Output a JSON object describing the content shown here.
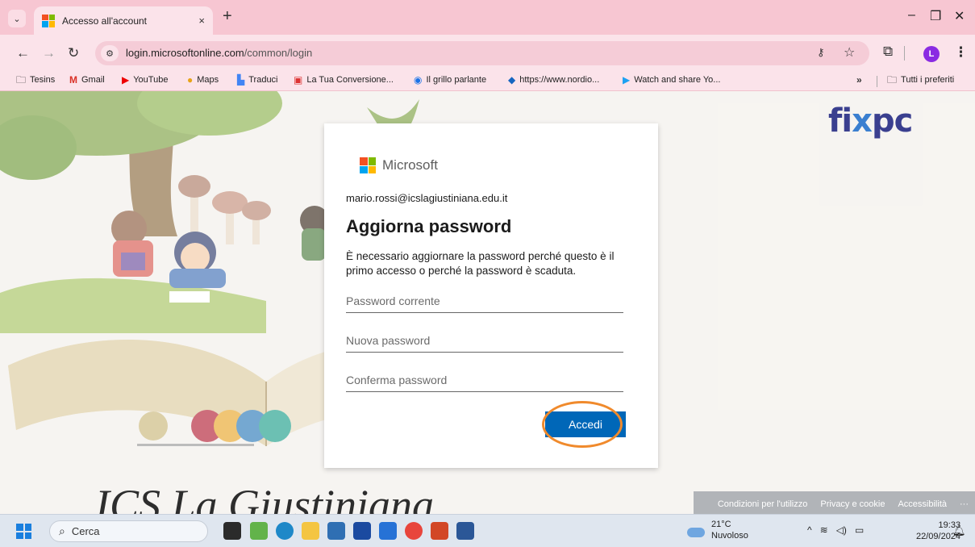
{
  "browser": {
    "tab_title": "Accesso all'account",
    "tab_close": "×",
    "new_tab": "+",
    "window_controls": {
      "minimize": "–",
      "restore": "❐",
      "close": "✕"
    },
    "url_host": "login.microsoftonline.com",
    "url_path": "/common/login",
    "profile_initial": "L",
    "bookmarks": [
      {
        "label": "Tesins",
        "icon": "folder-icon"
      },
      {
        "label": "Gmail",
        "icon": "gmail-icon"
      },
      {
        "label": "YouTube",
        "icon": "youtube-icon"
      },
      {
        "label": "Maps",
        "icon": "maps-icon"
      },
      {
        "label": "Traduci",
        "icon": "translate-icon"
      },
      {
        "label": "La Tua Conversione...",
        "icon": "convert-icon"
      },
      {
        "label": "Il grillo parlante",
        "icon": "grillo-icon"
      },
      {
        "label": "https://www.nordio...",
        "icon": "site-icon"
      },
      {
        "label": "Watch and share Yo...",
        "icon": "video-icon"
      }
    ],
    "bookmarks_more": "»",
    "all_bookmarks": "Tutti i preferiti"
  },
  "dialog": {
    "brand": "Microsoft",
    "account": "mario.rossi@icslagiustiniana.edu.it",
    "title": "Aggiorna password",
    "description": "È necessario aggiornare la password perché questo è il primo accesso o perché la password è scaduta.",
    "current_password_placeholder": "Password corrente",
    "new_password_placeholder": "Nuova password",
    "confirm_password_placeholder": "Conferma password",
    "submit_label": "Accedi"
  },
  "page": {
    "school_name": "ICS La Giustiniana",
    "sponsor_logo": "fixpc",
    "footer_links": [
      "Condizioni per l'utilizzo",
      "Privacy e cookie",
      "Accessibilità",
      "···"
    ]
  },
  "taskbar": {
    "search_placeholder": "Cerca",
    "weather_temp": "21°C",
    "weather_desc": "Nuvoloso",
    "time": "19:33",
    "date": "22/09/2024"
  },
  "colors": {
    "chrome_pink": "#f7c6d2",
    "ms_blue": "#0067b8",
    "highlight_orange": "#f08a2c",
    "ms_red": "#f25022",
    "ms_green": "#7fba00",
    "ms_blue_tile": "#00a4ef",
    "ms_yellow": "#ffb900"
  }
}
